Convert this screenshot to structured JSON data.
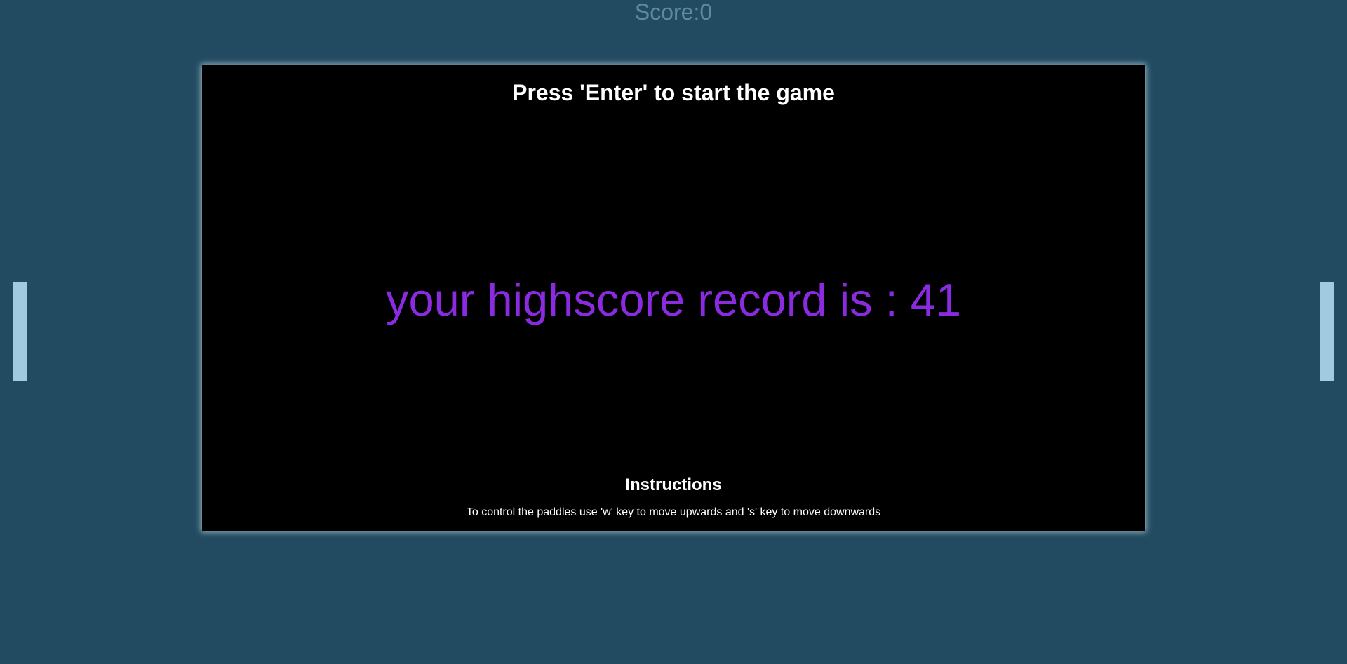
{
  "score": {
    "text": "Score:0"
  },
  "board": {
    "title": "Press 'Enter' to start the game",
    "highscore": "your highscore record is : 41",
    "instructions_heading": "Instructions",
    "instructions_text": "To control the paddles use 'w' key to move upwards and 's' key to move downwards"
  },
  "colors": {
    "background": "#224b61",
    "paddle": "#a1c9df",
    "highscore": "#8a2be2",
    "score": "#5d8aa3"
  }
}
